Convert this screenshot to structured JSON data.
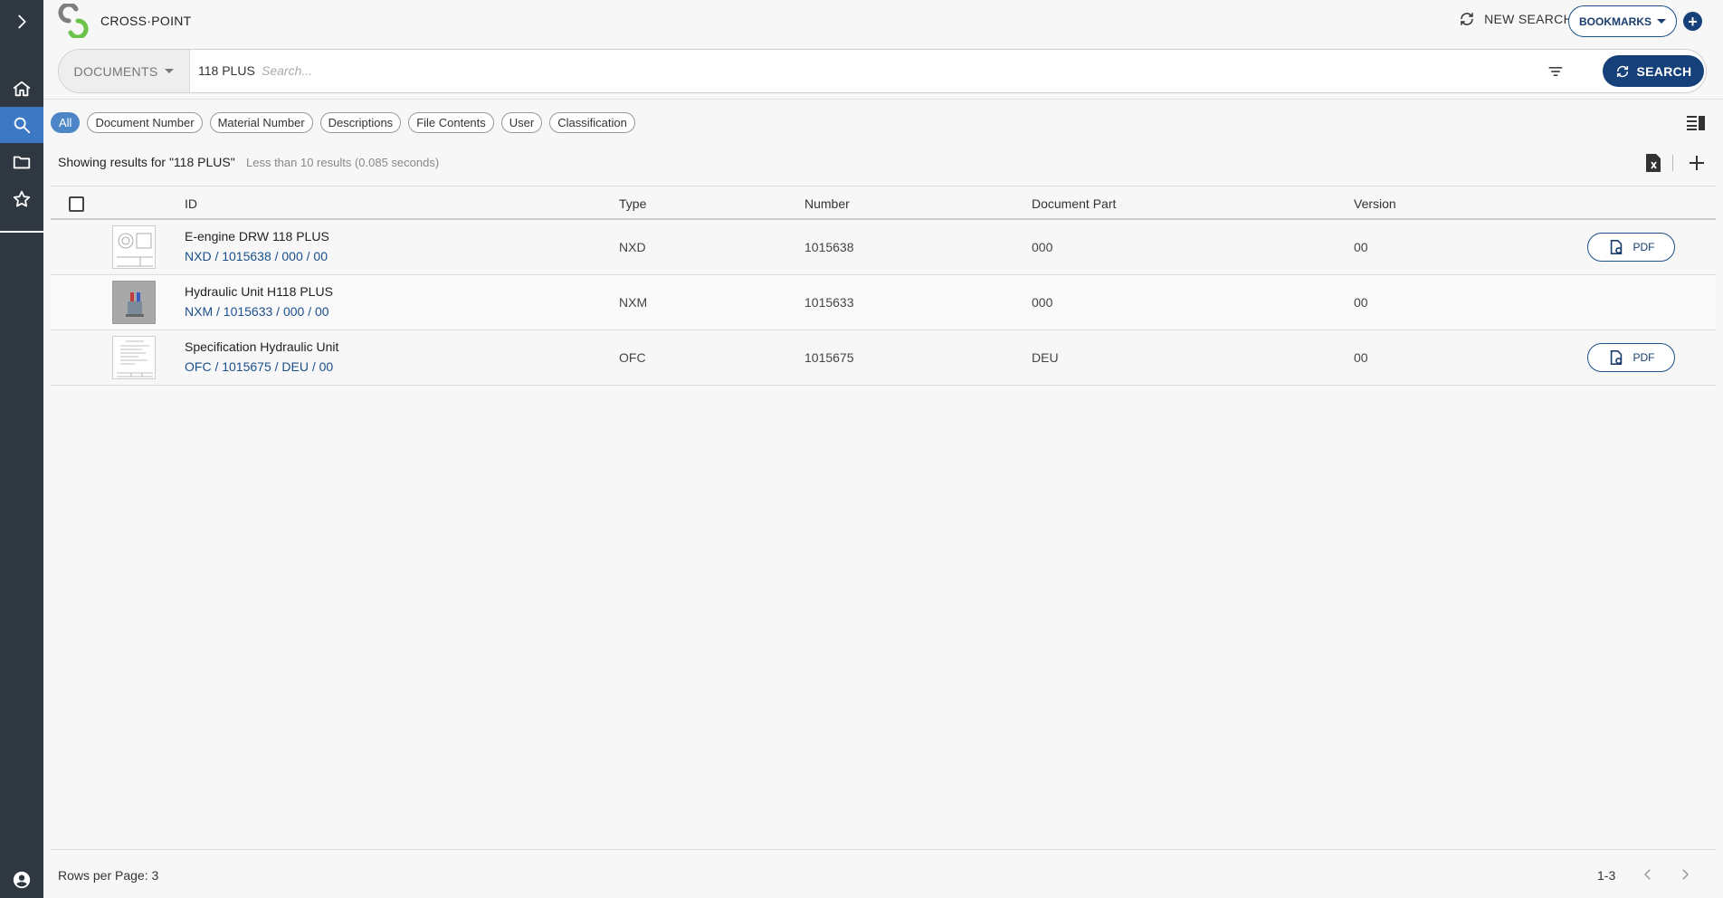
{
  "app": {
    "brand": "CROSS·POINT"
  },
  "header": {
    "new_search": "NEW SEARCH",
    "bookmarks": "BOOKMARKS"
  },
  "search": {
    "category": "DOCUMENTS",
    "query": "118 PLUS",
    "placeholder": "Search...",
    "button": "SEARCH"
  },
  "chips": [
    "All",
    "Document Number",
    "Material Number",
    "Descriptions",
    "File Contents",
    "User",
    "Classification"
  ],
  "results": {
    "showing": "Showing results for \"118 PLUS\"",
    "meta": "Less than 10 results (0.085 seconds)"
  },
  "table": {
    "columns": {
      "id": "ID",
      "type": "Type",
      "number": "Number",
      "part": "Document Part",
      "version": "Version"
    },
    "rows": [
      {
        "title": "E-engine DRW 118 PLUS",
        "sub": "NXD / 1015638 / 000 / 00",
        "type": "NXD",
        "number": "1015638",
        "part": "000",
        "version": "00",
        "pdf": "PDF"
      },
      {
        "title": "Hydraulic Unit H118 PLUS",
        "sub": "NXM / 1015633 / 000 / 00",
        "type": "NXM",
        "number": "1015633",
        "part": "000",
        "version": "00"
      },
      {
        "title": "Specification Hydraulic Unit",
        "sub": "OFC / 1015675 / DEU / 00",
        "type": "OFC",
        "number": "1015675",
        "part": "DEU",
        "version": "00",
        "pdf": "PDF"
      }
    ]
  },
  "footer": {
    "rows_per_page": "Rows per Page: 3",
    "range": "1-3"
  },
  "icons": {
    "sidebar": [
      "chevron-right-icon",
      "home-icon",
      "search-icon",
      "folder-icon",
      "star-icon",
      "account-icon"
    ],
    "accent": "#15407a",
    "sidebar_bg": "#2f3841",
    "sidebar_active": "#3d78c4"
  }
}
